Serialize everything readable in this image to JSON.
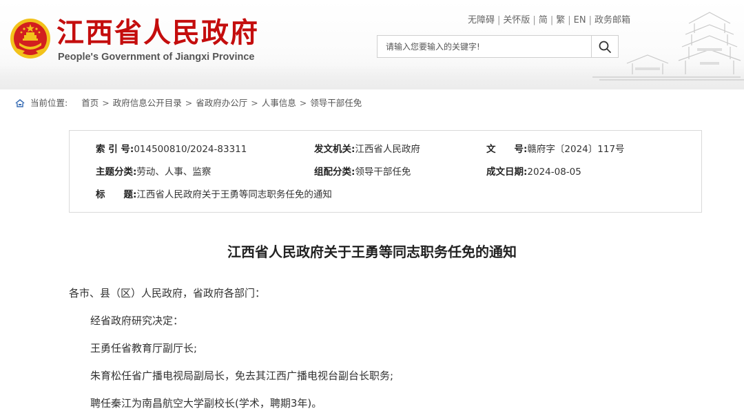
{
  "header": {
    "site_title": "江西省人民政府",
    "site_subtitle": "People's Government of Jiangxi Province",
    "top_links": [
      "无障碍",
      "关怀版",
      "简",
      "繁",
      "EN",
      "政务邮箱"
    ],
    "search_placeholder": "请输入您要输入的关键字!",
    "colors": {
      "brand_red": "#c40d0d",
      "emblem_gold": "#f2c21b"
    }
  },
  "breadcrumb": {
    "icon": "home-icon",
    "label": "当前位置:",
    "items": [
      "首页",
      "政府信息公开目录",
      "省政府办公厅",
      "人事信息",
      "领导干部任免"
    ]
  },
  "info": {
    "index_no_label": "索 引 号:",
    "index_no": "014500810/2024-83311",
    "issuer_label": "发文机关:",
    "issuer": "江西省人民政府",
    "doc_no_label": "文　　号:",
    "doc_no": "赣府字〔2024〕117号",
    "topic_label": "主题分类:",
    "topic": "劳动、人事、监察",
    "category_label": "组配分类:",
    "category": "领导干部任免",
    "date_label": "成文日期:",
    "date": "2024-08-05",
    "title_label": "标　　题:",
    "title": "江西省人民政府关于王勇等同志职务任免的通知"
  },
  "article": {
    "title": "江西省人民政府关于王勇等同志职务任免的通知",
    "salutation": "各市、县（区）人民政府，省政府各部门：",
    "paragraphs": [
      "经省政府研究决定：",
      "王勇任省教育厅副厅长;",
      "朱育松任省广播电视局副局长，免去其江西广播电视台副台长职务;",
      "聘任秦江为南昌航空大学副校长(学术，聘期3年)。"
    ]
  }
}
